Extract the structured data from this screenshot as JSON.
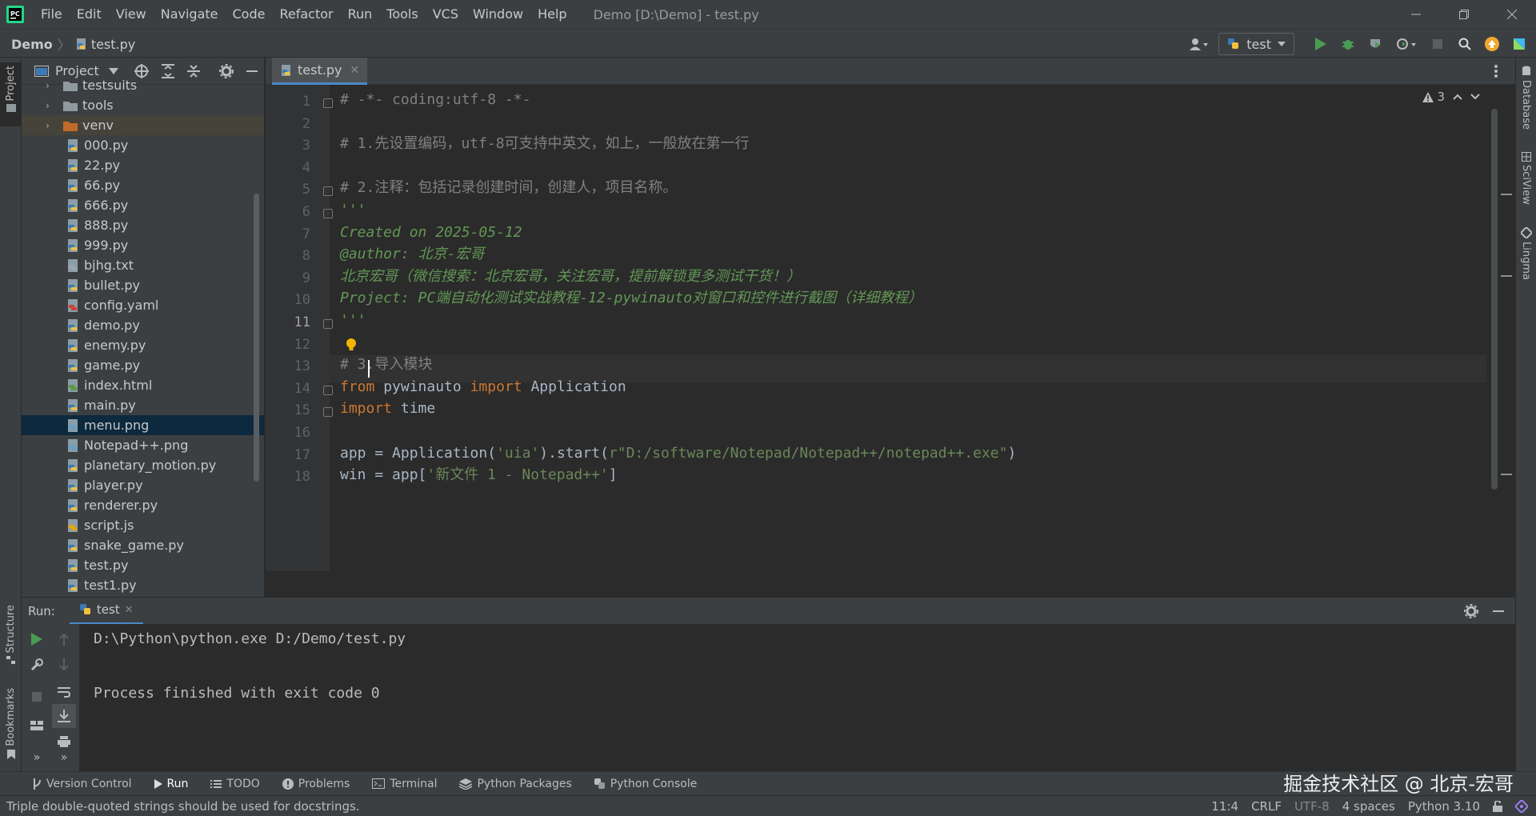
{
  "menubar": {
    "items": [
      "File",
      "Edit",
      "View",
      "Navigate",
      "Code",
      "Refactor",
      "Run",
      "Tools",
      "VCS",
      "Window",
      "Help"
    ],
    "window_title": "Demo [D:\\Demo] - test.py"
  },
  "navbar": {
    "project": "Demo",
    "file": "test.py",
    "run_config": "test"
  },
  "project_panel": {
    "title": "Project",
    "tree": [
      {
        "name": "testsuits",
        "kind": "folder"
      },
      {
        "name": "tools",
        "kind": "folder"
      },
      {
        "name": "venv",
        "kind": "folder-excluded"
      },
      {
        "name": "000.py",
        "kind": "py"
      },
      {
        "name": "22.py",
        "kind": "py"
      },
      {
        "name": "66.py",
        "kind": "py"
      },
      {
        "name": "666.py",
        "kind": "py"
      },
      {
        "name": "888.py",
        "kind": "py"
      },
      {
        "name": "999.py",
        "kind": "py"
      },
      {
        "name": "bjhg.txt",
        "kind": "txt"
      },
      {
        "name": "bullet.py",
        "kind": "py"
      },
      {
        "name": "config.yaml",
        "kind": "yaml"
      },
      {
        "name": "demo.py",
        "kind": "py"
      },
      {
        "name": "enemy.py",
        "kind": "py"
      },
      {
        "name": "game.py",
        "kind": "py"
      },
      {
        "name": "index.html",
        "kind": "html"
      },
      {
        "name": "main.py",
        "kind": "py"
      },
      {
        "name": "menu.png",
        "kind": "img",
        "selected": true
      },
      {
        "name": "Notepad++.png",
        "kind": "img"
      },
      {
        "name": "planetary_motion.py",
        "kind": "py"
      },
      {
        "name": "player.py",
        "kind": "py"
      },
      {
        "name": "renderer.py",
        "kind": "py"
      },
      {
        "name": "script.js",
        "kind": "js"
      },
      {
        "name": "snake_game.py",
        "kind": "py"
      },
      {
        "name": "test.py",
        "kind": "py"
      },
      {
        "name": "test1.py",
        "kind": "py"
      }
    ]
  },
  "editor": {
    "tab": "test.py",
    "warnings": "3",
    "lines": [
      {
        "n": "1",
        "parts": [
          {
            "t": "# -*- coding:utf-8 -*-",
            "c": "c-comment"
          }
        ]
      },
      {
        "n": "2",
        "parts": []
      },
      {
        "n": "3",
        "parts": [
          {
            "t": "# 1.先设置编码，utf-8可支持中英文，如上，一般放在第一行",
            "c": "c-comment"
          }
        ]
      },
      {
        "n": "4",
        "parts": []
      },
      {
        "n": "5",
        "parts": [
          {
            "t": "# 2.注释：包括记录创建时间，创建人，项目名称。",
            "c": "c-comment"
          }
        ]
      },
      {
        "n": "6",
        "parts": [
          {
            "t": "'''",
            "c": "c-doc"
          }
        ]
      },
      {
        "n": "7",
        "parts": [
          {
            "t": "Created on 2025-05-12",
            "c": "c-doc"
          }
        ]
      },
      {
        "n": "8",
        "parts": [
          {
            "t": "@author: 北京-宏哥",
            "c": "c-doc"
          }
        ]
      },
      {
        "n": "9",
        "parts": [
          {
            "t": "北京宏哥（微信搜索：北京宏哥，关注宏哥，提前解锁更多测试干货！）",
            "c": "c-doc"
          }
        ]
      },
      {
        "n": "10",
        "parts": [
          {
            "t": "Project: PC端自动化测试实战教程-12-pywinauto对窗口和控件进行截图（详细教程）",
            "c": "c-doc"
          }
        ]
      },
      {
        "n": "11",
        "parts": [
          {
            "t": "'''",
            "c": "c-doc"
          }
        ]
      },
      {
        "n": "12",
        "parts": []
      },
      {
        "n": "13",
        "parts": [
          {
            "t": "# 3.导入模块",
            "c": "c-comment"
          }
        ]
      },
      {
        "n": "14",
        "parts": [
          {
            "t": "from",
            "c": "c-kw"
          },
          {
            "t": " pywinauto ",
            "c": ""
          },
          {
            "t": "import",
            "c": "c-kw"
          },
          {
            "t": " Application",
            "c": ""
          }
        ]
      },
      {
        "n": "15",
        "parts": [
          {
            "t": "import",
            "c": "c-kw"
          },
          {
            "t": " time",
            "c": ""
          }
        ]
      },
      {
        "n": "16",
        "parts": []
      },
      {
        "n": "17",
        "parts": [
          {
            "t": "app = Application(",
            "c": ""
          },
          {
            "t": "'uia'",
            "c": "c-str"
          },
          {
            "t": ").start(",
            "c": ""
          },
          {
            "t": "r\"D:/software/Notepad/Notepad++/notepad++.exe\"",
            "c": "c-str"
          },
          {
            "t": ")",
            "c": ""
          }
        ]
      },
      {
        "n": "18",
        "parts": [
          {
            "t": "win = app[",
            "c": ""
          },
          {
            "t": "'新文件 1 - Notepad++'",
            "c": "c-str"
          },
          {
            "t": "]",
            "c": ""
          }
        ]
      }
    ]
  },
  "right_stripe": [
    "Database",
    "SciView",
    "Lingma"
  ],
  "left_stripe": [
    "Project",
    "Structure",
    "Bookmarks"
  ],
  "run_panel": {
    "label": "Run:",
    "tab": "test",
    "output": [
      "D:\\Python\\python.exe D:/Demo/test.py",
      "",
      "Process finished with exit code 0"
    ]
  },
  "bottom_bar": {
    "items": [
      "Version Control",
      "Run",
      "TODO",
      "Problems",
      "Terminal",
      "Python Packages",
      "Python Console"
    ],
    "watermark": "掘金技术社区 @ 北京-宏哥"
  },
  "status_bar": {
    "message": "Triple double-quoted strings should be used for docstrings.",
    "position": "11:4",
    "line_sep": "CRLF",
    "encoding": "UTF-8",
    "indent": "4 spaces",
    "interpreter": "Python 3.10"
  },
  "colors": {
    "accent": "#4a88c7",
    "run_green": "#499c54",
    "keyword": "#cc7832",
    "docstring": "#629755",
    "string": "#6a8759",
    "comment": "#808080"
  }
}
